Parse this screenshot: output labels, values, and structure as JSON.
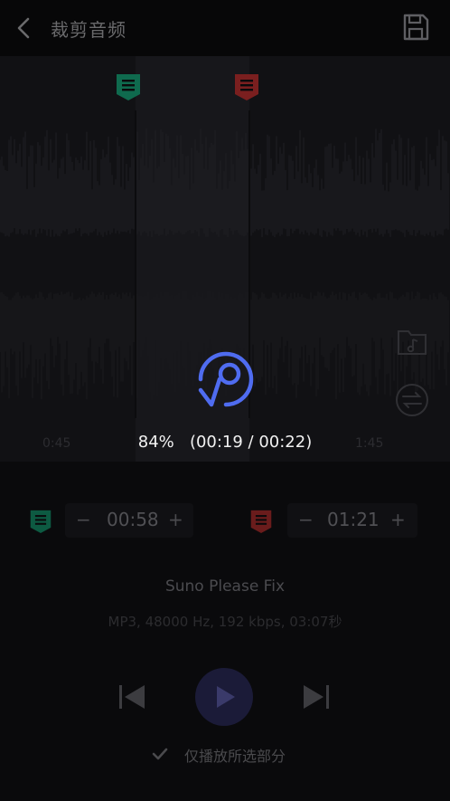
{
  "header": {
    "title": "裁剪音频",
    "back_icon": "chevron-left-icon",
    "save_icon": "save-icon"
  },
  "waveform": {
    "tick_labels": [
      "0:45",
      "1:45"
    ]
  },
  "loading": {
    "percent": "84%",
    "time": "(00:19 / 00:22)",
    "progress_fraction": 0.84,
    "accent": "#4f6cf0"
  },
  "start_marker": {
    "time": "00:58",
    "color": "#0f6a4e"
  },
  "end_marker": {
    "time": "01:21",
    "color": "#7a1f1f"
  },
  "song": {
    "title": "Suno Please Fix",
    "info": "MP3, 48000 Hz, 192 kbps, 03:07秒"
  },
  "playback": {
    "only_selected_label": "仅播放所选部分",
    "only_selected_checked": true
  }
}
